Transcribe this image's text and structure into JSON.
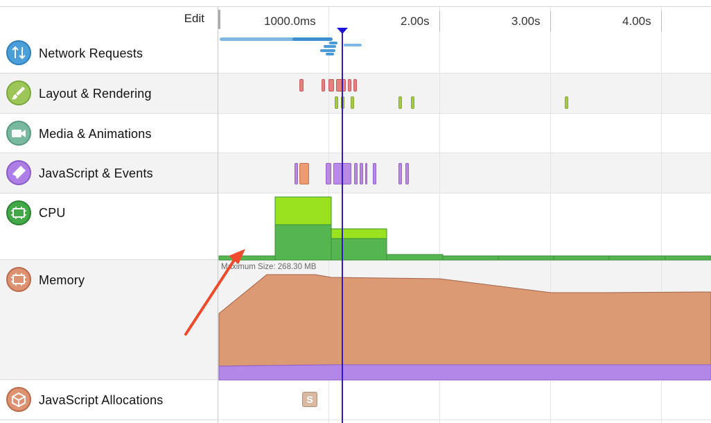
{
  "toolbar": {
    "edit_label": "Edit"
  },
  "timeline": {
    "ticks": [
      {
        "label": "1000.0ms"
      },
      {
        "label": "2.00s"
      },
      {
        "label": "3.00s"
      },
      {
        "label": "4.00s"
      }
    ]
  },
  "tracks": [
    {
      "name": "Network Requests",
      "icon": "network-arrows-icon",
      "color": "#4a9fd8"
    },
    {
      "name": "Layout & Rendering",
      "icon": "paintbrush-icon",
      "color": "#8cc152"
    },
    {
      "name": "Media & Animations",
      "icon": "video-camera-icon",
      "color": "#6fb59a"
    },
    {
      "name": "JavaScript & Events",
      "icon": "script-icon",
      "color": "#a874e0"
    },
    {
      "name": "CPU",
      "icon": "cpu-chip-icon",
      "color": "#2f9b3c"
    },
    {
      "name": "Memory",
      "icon": "memory-chip-icon",
      "color": "#d88a62"
    },
    {
      "name": "JavaScript Allocations",
      "icon": "cube-icon",
      "color": "#d88a62"
    }
  ],
  "memory": {
    "max_size_label": "Maximum Size: 268.30 MB"
  },
  "allocations": {
    "snapshot_label": "S"
  },
  "colors": {
    "playhead": "#3217c4",
    "cpu_main": "#55b551",
    "cpu_high": "#9ae21e",
    "memory_fill": "#dc9a74",
    "memory_js": "#b287e6",
    "layout_red": "#e57b7b",
    "layout_green": "#a4c846",
    "js_purple": "#b88ae4",
    "js_orange": "#ec9c74",
    "annotation_arrow": "#f04a2c"
  }
}
